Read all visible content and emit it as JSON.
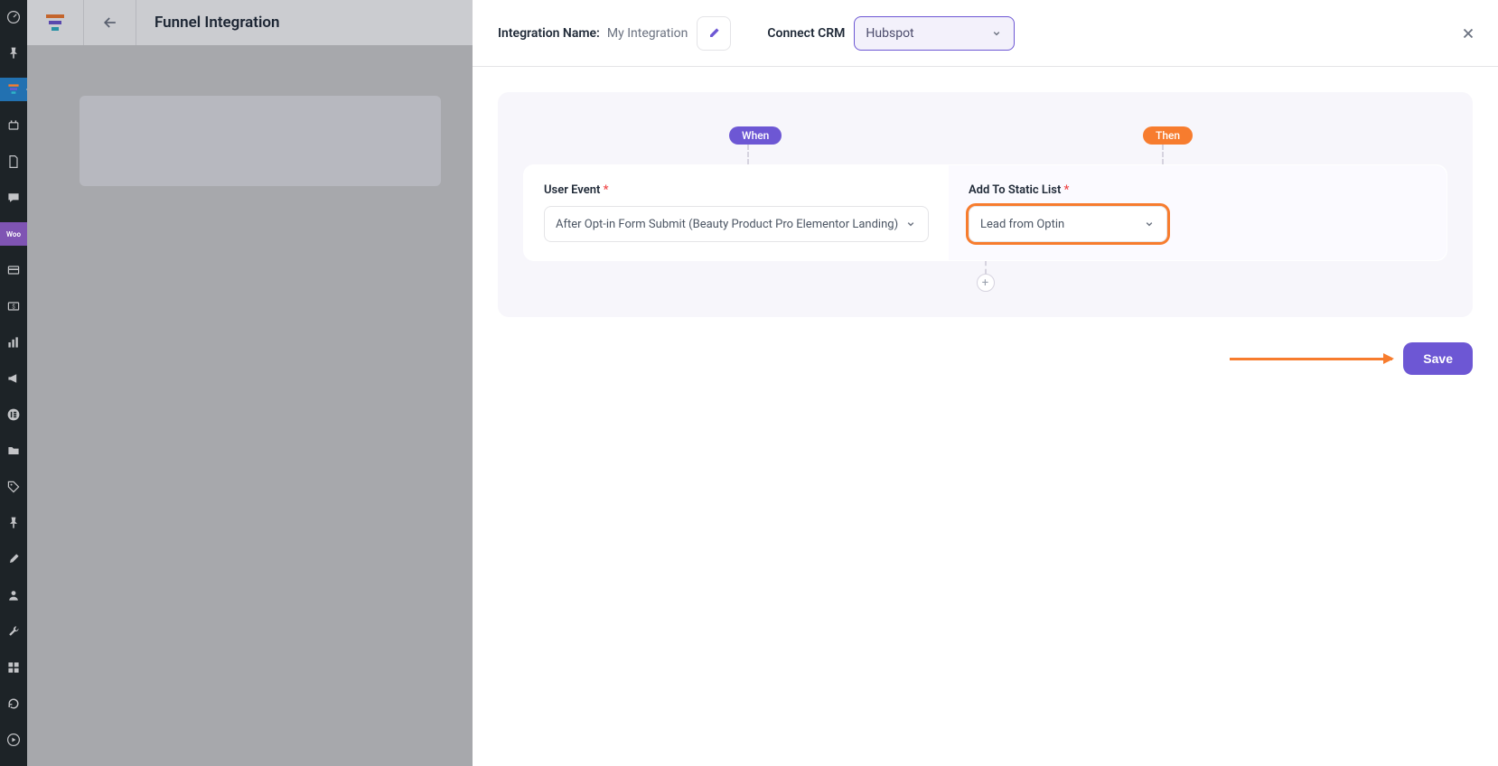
{
  "header": {
    "page_title": "Funnel Integration"
  },
  "modal": {
    "integration_name_label": "Integration Name:",
    "integration_name_value": "My Integration",
    "connect_crm_label": "Connect CRM",
    "crm_selected": "Hubspot",
    "pills": {
      "when": "When",
      "then": "Then"
    },
    "when_block": {
      "label": "User Event",
      "required_mark": "*",
      "value": "After Opt-in Form Submit (Beauty Product Pro Elementor Landing)"
    },
    "then_block": {
      "label": "Add To Static List",
      "required_mark": "*",
      "value": "Lead from Optin"
    },
    "add_icon": "+",
    "save_label": "Save"
  },
  "rail_icons": [
    "dashboard-icon",
    "pin-icon",
    "funnel-icon",
    "plugin-icon",
    "page-icon",
    "comment-icon",
    "woo-icon",
    "card-icon",
    "dollar-icon",
    "analytics-icon",
    "megaphone-icon",
    "elementor-icon",
    "folder-icon",
    "tag-icon",
    "pushpin-icon",
    "brush-icon",
    "users-icon",
    "tools-icon",
    "grid-icon",
    "refresh-icon",
    "play-icon"
  ],
  "colors": {
    "accent": "#6d57d4",
    "highlight": "#f77c2e"
  }
}
